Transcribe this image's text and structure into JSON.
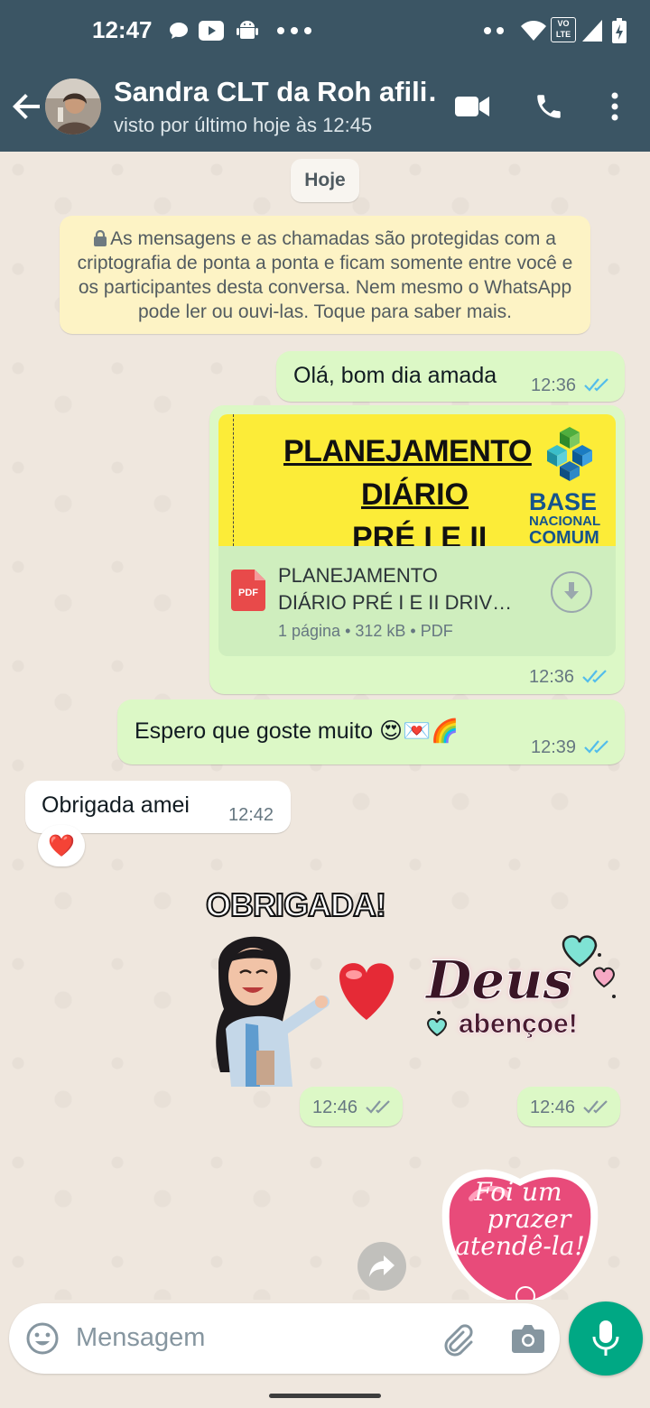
{
  "status_bar": {
    "time": "12:47",
    "network_badge_top": "VO",
    "network_badge_bottom": "LTE"
  },
  "header": {
    "contact_name": "Sandra CLT da Roh afili…",
    "last_seen": "visto por último hoje às 12:45"
  },
  "chat": {
    "day_chip": "Hoje",
    "encryption_notice": "As mensagens e as chamadas são protegidas com a criptografia de ponta a ponta e ficam somente entre você e os participantes desta conversa. Nem mesmo o WhatsApp pode ler ou ouvi-las. Toque para saber mais.",
    "messages": [
      {
        "direction": "out",
        "text": "Olá, bom dia amada",
        "time": "12:36",
        "status": "read"
      },
      {
        "direction": "out",
        "type": "document",
        "preview_line1": "PLANEJAMENTO",
        "preview_line2": "DIÁRIO",
        "preview_line3": "PRÉ I E II",
        "preview_logo_line1": "BASE",
        "preview_logo_line2": "NACIONAL",
        "preview_logo_line3": "COMUM",
        "file_badge": "PDF",
        "file_name_line1": "PLANEJAMENTO",
        "file_name_line2": "DIÁRIO PRÉ I E II DRIV…",
        "file_meta": "1 página • 312 kB • PDF",
        "time": "12:36",
        "status": "read"
      },
      {
        "direction": "out",
        "text": "Espero que goste muito 😍💌🌈",
        "time": "12:39",
        "status": "read"
      },
      {
        "direction": "in",
        "text": "Obrigada amei",
        "time": "12:42",
        "reaction": "❤️"
      },
      {
        "direction": "out",
        "type": "sticker",
        "sticker_text": "OBRIGADA!",
        "time": "12:46",
        "status": "delivered"
      },
      {
        "direction": "out",
        "type": "sticker",
        "sticker_text_line1": "Deus",
        "sticker_text_line2": "abençoe!",
        "time": "12:46",
        "status": "delivered"
      },
      {
        "direction": "out",
        "type": "sticker",
        "sticker_text_line1": "Foi um",
        "sticker_text_line2": "prazer",
        "sticker_text_line3": "atendê-la!"
      }
    ]
  },
  "composer": {
    "placeholder": "Mensagem"
  },
  "colors": {
    "header": "#3b5564",
    "outgoing_bubble": "#dcf8c6",
    "incoming_bubble": "#ffffff",
    "read_ticks": "#53bdeb",
    "delivered_ticks": "#8696a0",
    "mic_button": "#00a884",
    "chat_background": "#efe7de"
  },
  "icons": [
    "back-arrow-icon",
    "video-call-icon",
    "phone-icon",
    "more-vert-icon",
    "lock-icon",
    "pdf-icon",
    "download-icon",
    "forward-icon",
    "emoji-icon",
    "attach-icon",
    "camera-icon",
    "mic-icon"
  ]
}
